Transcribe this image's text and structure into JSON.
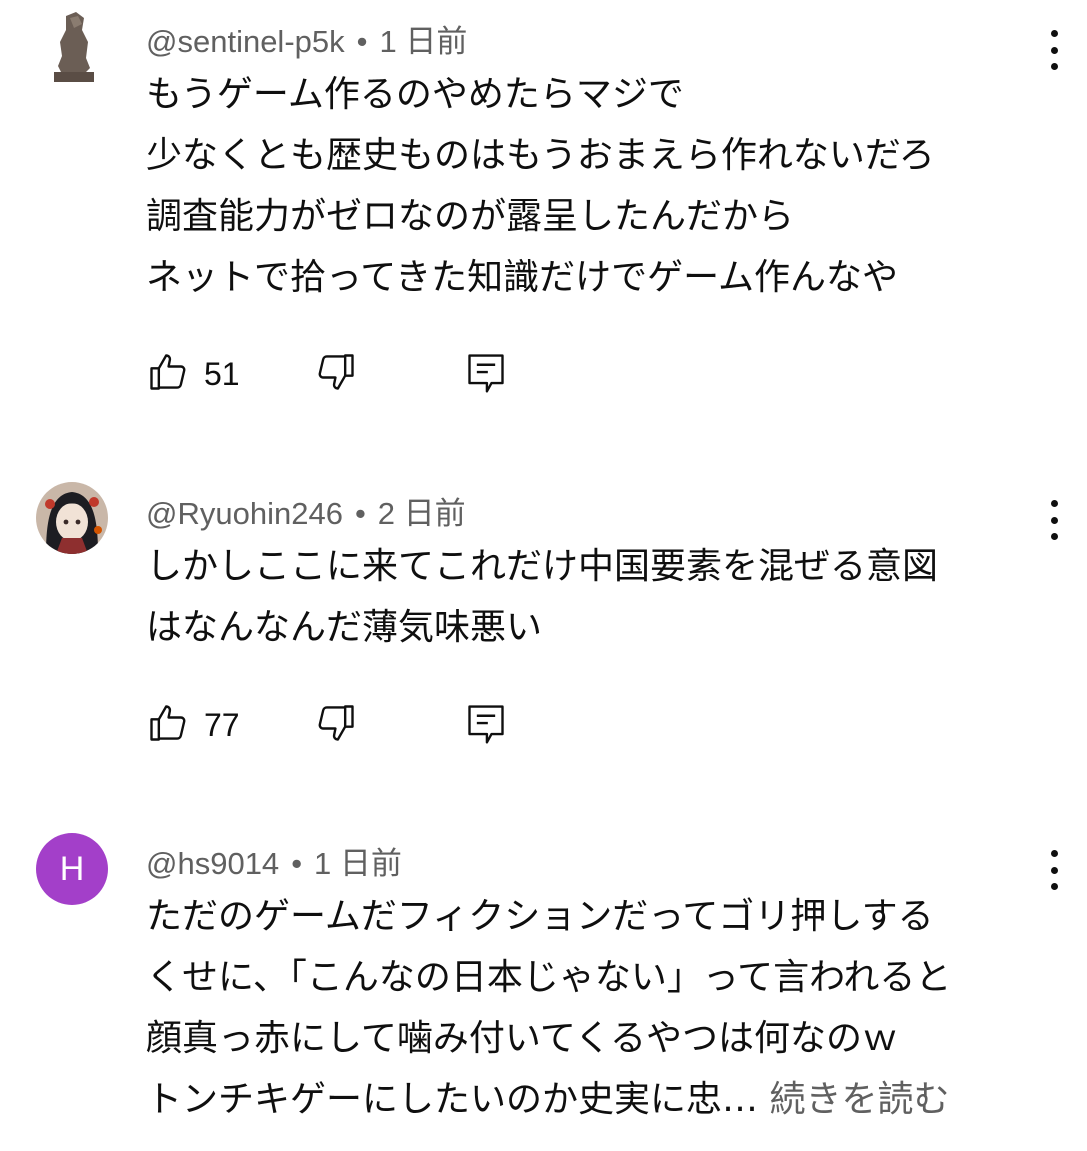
{
  "comments": [
    {
      "author": "@sentinel-p5k",
      "separator": "•",
      "time": "1 日前",
      "lines": [
        "もうゲーム作るのやめたらマジで",
        "少なくとも歴史ものはもうおまえら作れないだろ",
        "調査能力がゼロなのが露呈したんだから",
        "ネットで拾ってきた知識だけでゲーム作んなや"
      ],
      "likes": "51",
      "avatar_icon": "statue-avatar-icon"
    },
    {
      "author": "@Ryuohin246",
      "separator": "•",
      "time": "2 日前",
      "lines": [
        "しかしここに来てこれだけ中国要素を混ぜる意図",
        "はなんなんだ薄気味悪い"
      ],
      "likes": "77",
      "avatar_icon": "anime-girl-avatar-icon"
    },
    {
      "author": "@hs9014",
      "separator": "•",
      "time": "1 日前",
      "lines": [
        "ただのゲームだフィクションだってゴリ押しする",
        "くせに、「こんなの日本じゃない」って言われると",
        "顔真っ赤にして噛み付いてくるやつは何なのｗ",
        "トンチキゲーにしたいのか史実に忠…"
      ],
      "read_more": "続きを読む",
      "avatar_letter": "H",
      "avatar_color": "#a33fc9"
    }
  ],
  "icons": {
    "like": "thumbs-up-icon",
    "dislike": "thumbs-down-icon",
    "reply": "reply-icon",
    "menu": "more-vert-icon"
  }
}
